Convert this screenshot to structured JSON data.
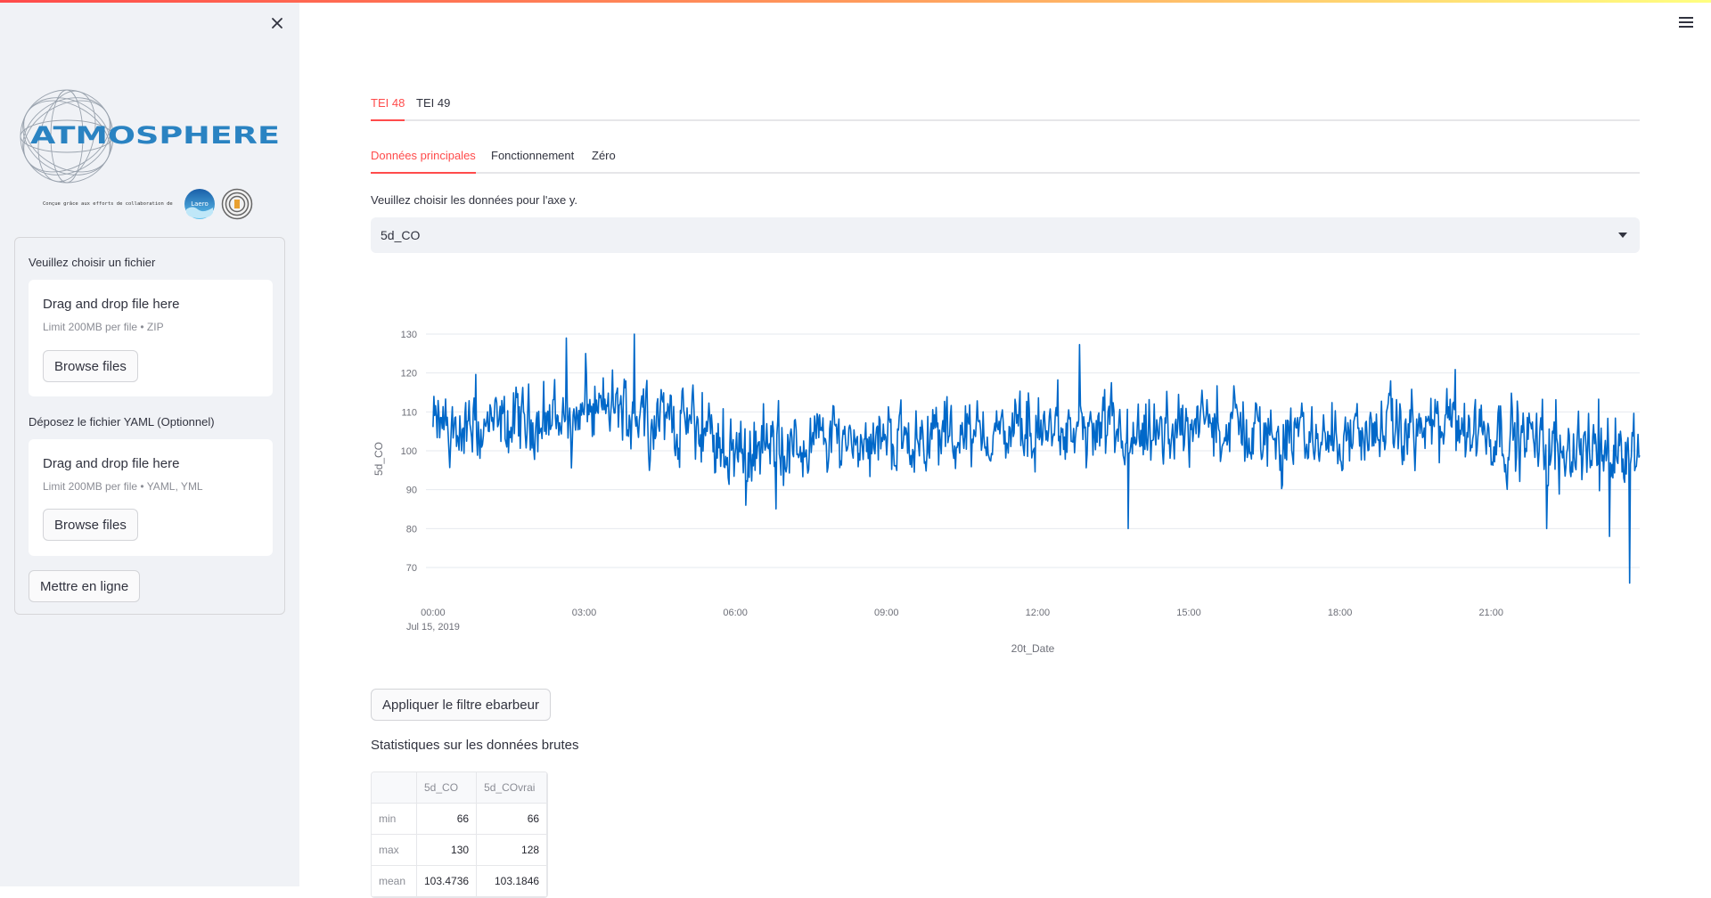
{
  "app": {
    "accent_color": "#ff4b4b",
    "line_color": "#0068c9"
  },
  "sidebar": {
    "close_icon": "close-icon",
    "logo_text": "ATMOSPHERE",
    "collab_text": "Conçue grâce aux efforts de collaboration de",
    "partner_logos": [
      "Laero",
      "partner-spiral"
    ],
    "uploader_zip": {
      "label": "Veuillez choisir un fichier",
      "title": "Drag and drop file here",
      "limit": "Limit 200MB per file • ZIP",
      "button": "Browse files"
    },
    "uploader_yaml": {
      "label": "Déposez le fichier YAML (Optionnel)",
      "title": "Drag and drop file here",
      "limit": "Limit 200MB per file • YAML, YML",
      "button": "Browse files"
    },
    "submit_button": "Mettre en ligne"
  },
  "header": {
    "menu_icon": "hamburger-menu-icon"
  },
  "main": {
    "tabs": [
      {
        "label": "TEI 48",
        "active": true
      },
      {
        "label": "TEI 49",
        "active": false
      }
    ],
    "subtabs": [
      {
        "label": "Données principales",
        "active": true
      },
      {
        "label": "Fonctionnement",
        "active": false
      },
      {
        "label": "Zéro",
        "active": false
      }
    ],
    "select_label": "Veuillez choisir les données pour l'axe y.",
    "select_value": "5d_CO",
    "filter_button": "Appliquer le filtre ebarbeur",
    "stats_title": "Statistiques sur les données brutes",
    "stats_table": {
      "columns": [
        "",
        "5d_CO",
        "5d_COvrai"
      ],
      "rows": [
        {
          "name": "min",
          "values": [
            "66",
            "66"
          ]
        },
        {
          "name": "max",
          "values": [
            "130",
            "128"
          ]
        },
        {
          "name": "mean",
          "values": [
            "103.4736",
            "103.1846"
          ]
        }
      ]
    }
  },
  "chart_data": {
    "type": "line",
    "title": "",
    "xlabel": "20t_Date",
    "ylabel": "5d_CO",
    "x_ticks": [
      "00:00",
      "03:00",
      "06:00",
      "09:00",
      "12:00",
      "15:00",
      "18:00",
      "21:00"
    ],
    "x_tick_hours": [
      0,
      3,
      6,
      9,
      12,
      15,
      18,
      21
    ],
    "x_date_label": "Jul 15, 2019",
    "xlim_hours": [
      -0.14,
      23.95
    ],
    "y_ticks": [
      70,
      80,
      90,
      100,
      110,
      120,
      130
    ],
    "ylim": [
      63,
      131
    ],
    "grid": true,
    "series": [
      {
        "name": "5d_CO",
        "color": "#0068c9",
        "x_range_hours": [
          0,
          23.95
        ],
        "mean": 103.47,
        "min": 66,
        "max": 130,
        "segment_means_hourly": [
          106,
          105,
          108,
          110,
          111,
          107,
          100,
          100,
          104,
          103,
          104,
          104,
          105,
          104,
          101,
          107,
          106,
          103,
          104,
          105,
          106,
          105,
          102,
          101
        ],
        "notable_points": [
          {
            "hour": 2.65,
            "value": 129
          },
          {
            "hour": 4.0,
            "value": 130
          },
          {
            "hour": 6.2,
            "value": 86
          },
          {
            "hour": 13.8,
            "value": 80
          },
          {
            "hour": 22.1,
            "value": 80
          },
          {
            "hour": 23.35,
            "value": 78
          },
          {
            "hour": 23.75,
            "value": 66
          }
        ],
        "noise_amplitude": 7
      }
    ]
  }
}
